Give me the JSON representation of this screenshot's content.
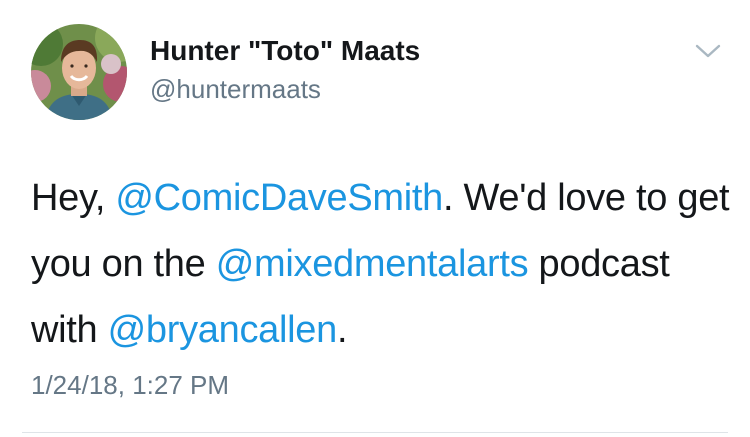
{
  "tweet": {
    "author": {
      "display_name": "Hunter \"Toto\" Maats",
      "handle": "@huntermaats"
    },
    "body": {
      "t1": "Hey, ",
      "m1": "@ComicDaveSmith",
      "t2": ". We'd love to get you on the ",
      "m2": "@mixedmentalarts",
      "t3": " podcast with ",
      "m3": "@bryancallen",
      "t4": "."
    },
    "timestamp": "1/24/18, 1:27 PM",
    "menu_icon": "chevron-down-icon"
  },
  "colors": {
    "link": "#1b95e0",
    "text": "#14171a",
    "secondary": "#657786",
    "divider": "#dfe4e8"
  }
}
